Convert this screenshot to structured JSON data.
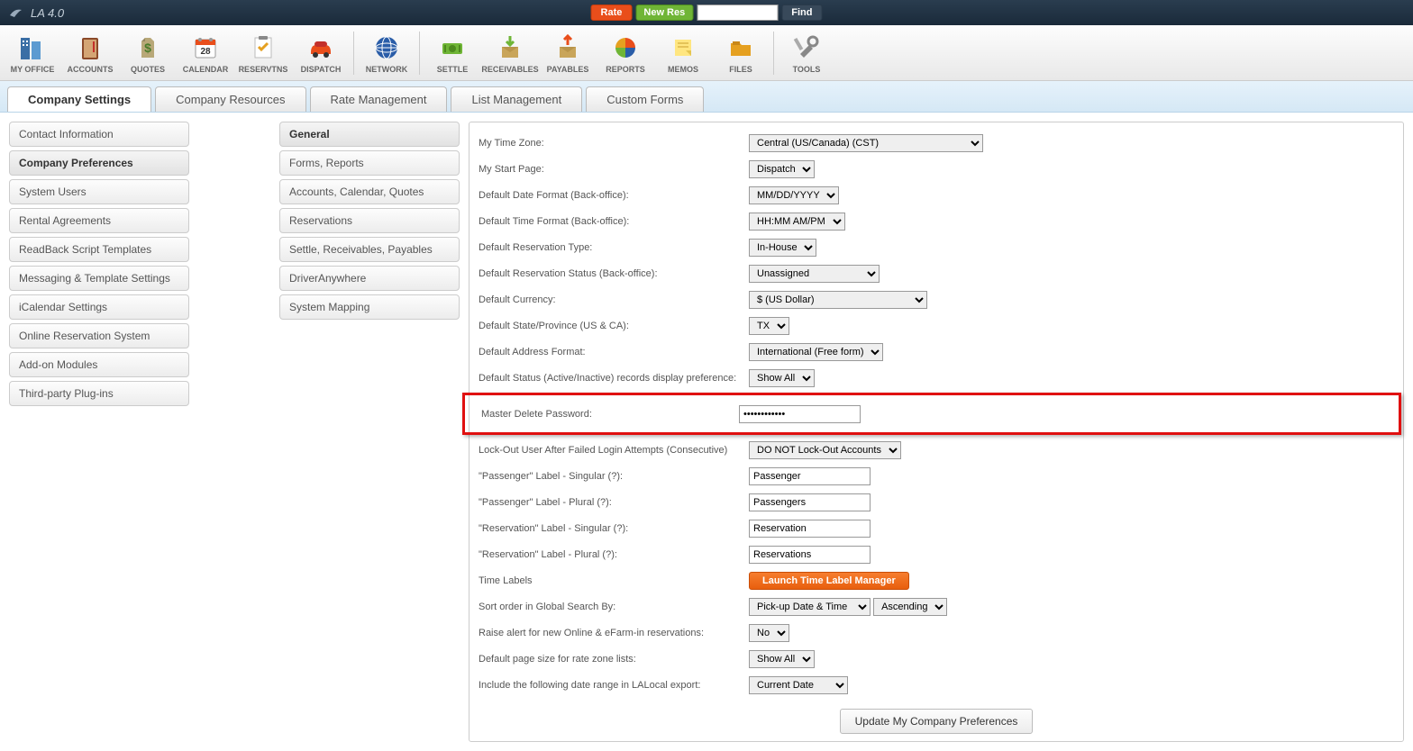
{
  "app_title": "LA 4.0",
  "topbar": {
    "rate": "Rate",
    "newres": "New Res",
    "find": "Find"
  },
  "toolbar": [
    {
      "label": "MY OFFICE",
      "icon": "office"
    },
    {
      "label": "ACCOUNTS",
      "icon": "accounts"
    },
    {
      "label": "QUOTES",
      "icon": "quotes"
    },
    {
      "label": "CALENDAR",
      "icon": "calendar"
    },
    {
      "label": "RESERVTNS",
      "icon": "reservations"
    },
    {
      "label": "DISPATCH",
      "icon": "dispatch"
    },
    {
      "label": "NETWORK",
      "icon": "network",
      "sep_before": true
    },
    {
      "label": "SETTLE",
      "icon": "settle",
      "sep_before": true
    },
    {
      "label": "RECEIVABLES",
      "icon": "receivables"
    },
    {
      "label": "PAYABLES",
      "icon": "payables"
    },
    {
      "label": "REPORTS",
      "icon": "reports"
    },
    {
      "label": "MEMOS",
      "icon": "memos"
    },
    {
      "label": "FILES",
      "icon": "files"
    },
    {
      "label": "TOOLS",
      "icon": "tools",
      "sep_before": true
    }
  ],
  "tabs": [
    {
      "label": "Company Settings",
      "active": true
    },
    {
      "label": "Company Resources"
    },
    {
      "label": "Rate Management"
    },
    {
      "label": "List Management"
    },
    {
      "label": "Custom Forms"
    }
  ],
  "leftnav": [
    {
      "label": "Contact Information"
    },
    {
      "label": "Company Preferences",
      "active": true
    },
    {
      "label": "System Users"
    },
    {
      "label": "Rental Agreements"
    },
    {
      "label": "ReadBack Script Templates"
    },
    {
      "label": "Messaging & Template Settings"
    },
    {
      "label": "iCalendar Settings"
    },
    {
      "label": "Online Reservation System"
    },
    {
      "label": "Add-on Modules"
    },
    {
      "label": "Third-party Plug-ins"
    }
  ],
  "subnav": [
    {
      "label": "General",
      "active": true
    },
    {
      "label": "Forms, Reports"
    },
    {
      "label": "Accounts, Calendar, Quotes"
    },
    {
      "label": "Reservations"
    },
    {
      "label": "Settle, Receivables, Payables"
    },
    {
      "label": "DriverAnywhere"
    },
    {
      "label": "System Mapping"
    }
  ],
  "form": {
    "timezone": {
      "label": "My Time Zone:",
      "value": "Central (US/Canada) (CST)"
    },
    "startpage": {
      "label": "My Start Page:",
      "value": "Dispatch"
    },
    "dateformat": {
      "label": "Default Date Format (Back-office):",
      "value": "MM/DD/YYYY"
    },
    "timeformat": {
      "label": "Default Time Format (Back-office):",
      "value": "HH:MM AM/PM"
    },
    "restype": {
      "label": "Default Reservation Type:",
      "value": "In-House"
    },
    "resstatus": {
      "label": "Default Reservation Status (Back-office):",
      "value": "Unassigned"
    },
    "currency": {
      "label": "Default Currency:",
      "value": "$ (US Dollar)"
    },
    "state": {
      "label": "Default State/Province (US & CA):",
      "value": "TX"
    },
    "addrformat": {
      "label": "Default Address Format:",
      "value": "International (Free form)"
    },
    "displaypref": {
      "label": "Default Status (Active/Inactive) records display preference:",
      "value": "Show All"
    },
    "masterpw": {
      "label": "Master Delete Password:",
      "value": "••••••••••••"
    },
    "lockout": {
      "label": "Lock-Out User After Failed Login Attempts (Consecutive)",
      "value": "DO NOT Lock-Out Accounts"
    },
    "passsing": {
      "label": "\"Passenger\" Label - Singular (?):",
      "value": "Passenger"
    },
    "passplu": {
      "label": "\"Passenger\" Label - Plural (?):",
      "value": "Passengers"
    },
    "ressing": {
      "label": "\"Reservation\" Label - Singular (?):",
      "value": "Reservation"
    },
    "resplu": {
      "label": "\"Reservation\" Label - Plural (?):",
      "value": "Reservations"
    },
    "timelabels": {
      "label": "Time Labels",
      "button": "Launch Time Label Manager"
    },
    "sortorder": {
      "label": "Sort order in Global Search By:",
      "value1": "Pick-up Date & Time",
      "value2": "Ascending"
    },
    "raisealert": {
      "label": "Raise alert for new Online & eFarm-in reservations:",
      "value": "No"
    },
    "pagesize": {
      "label": "Default page size for rate zone lists:",
      "value": "Show All"
    },
    "daterange": {
      "label": "Include the following date range in LALocal export:",
      "value": "Current Date"
    }
  },
  "update_button": "Update My Company Preferences"
}
